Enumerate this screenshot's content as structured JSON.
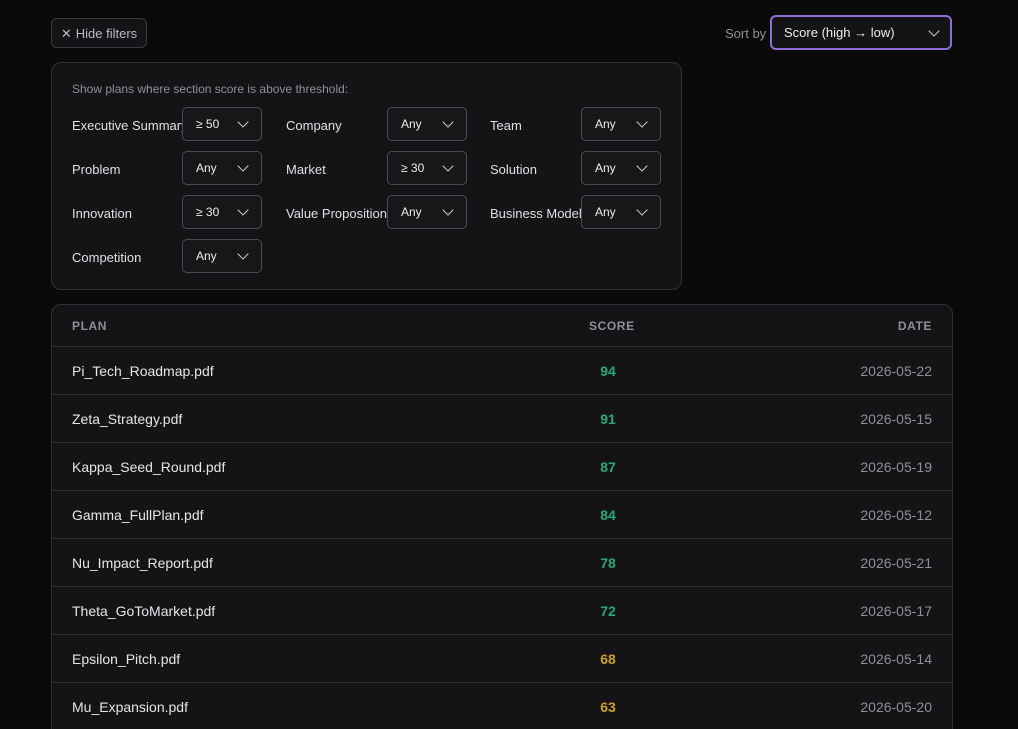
{
  "toolbar": {
    "hide_filters_label": "Hide filters",
    "sort_label": "Sort by",
    "sort_value": "Score (high → low)",
    "sort_accent_color": "#8f6fd6"
  },
  "filters": {
    "caption": "Show plans where section score is above threshold:",
    "items": [
      {
        "label": "Executive Summary",
        "value": "≥ 50"
      },
      {
        "label": "Company",
        "value": "Any"
      },
      {
        "label": "Team",
        "value": "Any"
      },
      {
        "label": "Problem",
        "value": "Any"
      },
      {
        "label": "Market",
        "value": "≥ 30"
      },
      {
        "label": "Solution",
        "value": "Any"
      },
      {
        "label": "Innovation",
        "value": "≥ 30"
      },
      {
        "label": "Value Proposition",
        "value": "Any"
      },
      {
        "label": "Business Model",
        "value": "Any"
      },
      {
        "label": "Competition",
        "value": "Any"
      }
    ]
  },
  "table": {
    "headers": {
      "plan": "PLAN",
      "score": "SCORE",
      "date": "DATE"
    },
    "rows": [
      {
        "plan": "Pi_Tech_Roadmap.pdf",
        "score": "94",
        "date": "2026-05-22",
        "tier": "high"
      },
      {
        "plan": "Zeta_Strategy.pdf",
        "score": "91",
        "date": "2026-05-15",
        "tier": "high"
      },
      {
        "plan": "Kappa_Seed_Round.pdf",
        "score": "87",
        "date": "2026-05-19",
        "tier": "high"
      },
      {
        "plan": "Gamma_FullPlan.pdf",
        "score": "84",
        "date": "2026-05-12",
        "tier": "high"
      },
      {
        "plan": "Nu_Impact_Report.pdf",
        "score": "78",
        "date": "2026-05-21",
        "tier": "high"
      },
      {
        "plan": "Theta_GoToMarket.pdf",
        "score": "72",
        "date": "2026-05-17",
        "tier": "high"
      },
      {
        "plan": "Epsilon_Pitch.pdf",
        "score": "68",
        "date": "2026-05-14",
        "tier": "mid"
      },
      {
        "plan": "Mu_Expansion.pdf",
        "score": "63",
        "date": "2026-05-20",
        "tier": "mid"
      }
    ],
    "colors": {
      "high": "#2aa77a",
      "mid": "#c9a227"
    }
  }
}
